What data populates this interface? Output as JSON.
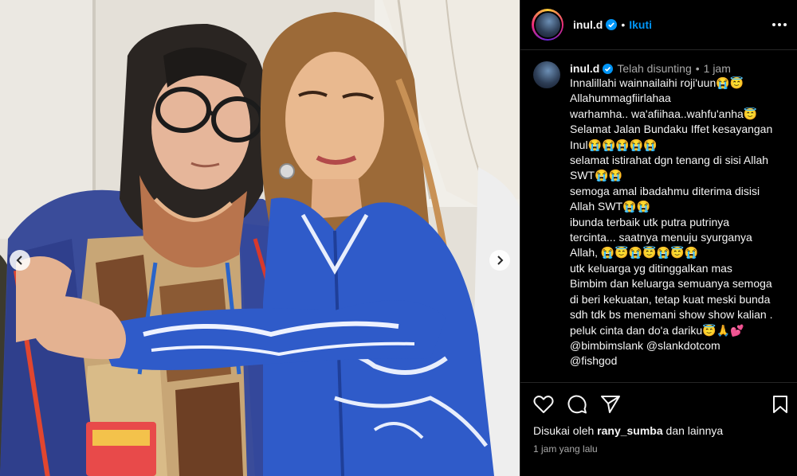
{
  "post": {
    "username": "inul.d",
    "follow_label": "Ikuti",
    "separator": "•",
    "edited_label": "Telah disunting",
    "time_short": "1 jam",
    "caption_lines": [
      "Innalillahi wainnailaihi roji'uun😭😇",
      "Allahummagfiirlahaa",
      "warhamha.. wa'afiihaa..wahfu'anha😇",
      "Selamat Jalan Bundaku Iffet kesayangan",
      "Inul😭😭😭😭😭",
      "selamat istirahat dgn tenang di sisi Allah",
      "SWT😭😭",
      "semoga amal ibadahmu diterima disisi",
      "Allah SWT😭😭",
      "ibunda terbaik utk putra putrinya",
      "tercinta... saatnya menuju syurganya",
      "Allah, 😭😇😭😇😭😇😭",
      "utk keluarga yg ditinggalkan mas",
      "Bimbim dan keluarga semuanya semoga",
      "di beri kekuatan, tetap kuat meski bunda",
      "sdh tdk bs menemani show show kalian .",
      "peluk cinta dan do'a dariku😇🙏💕",
      "@bimbimslank @slankdotcom",
      "@fishgod"
    ],
    "likes_prefix": "Disukai oleh",
    "likes_user": "rany_sumba",
    "likes_suffix": "dan lainnya",
    "time_long": "1 jam yang lalu"
  },
  "colors": {
    "background": "#000000",
    "link_blue": "#0095f6",
    "verified_blue": "#0095f6",
    "muted_text": "#a8a8a8",
    "divider": "#262626"
  },
  "icons": {
    "like": "heart-icon",
    "comment": "comment-icon",
    "share": "send-icon",
    "save": "bookmark-icon",
    "more": "more-options-icon",
    "prev": "chevron-left-icon",
    "next": "chevron-right-icon"
  }
}
